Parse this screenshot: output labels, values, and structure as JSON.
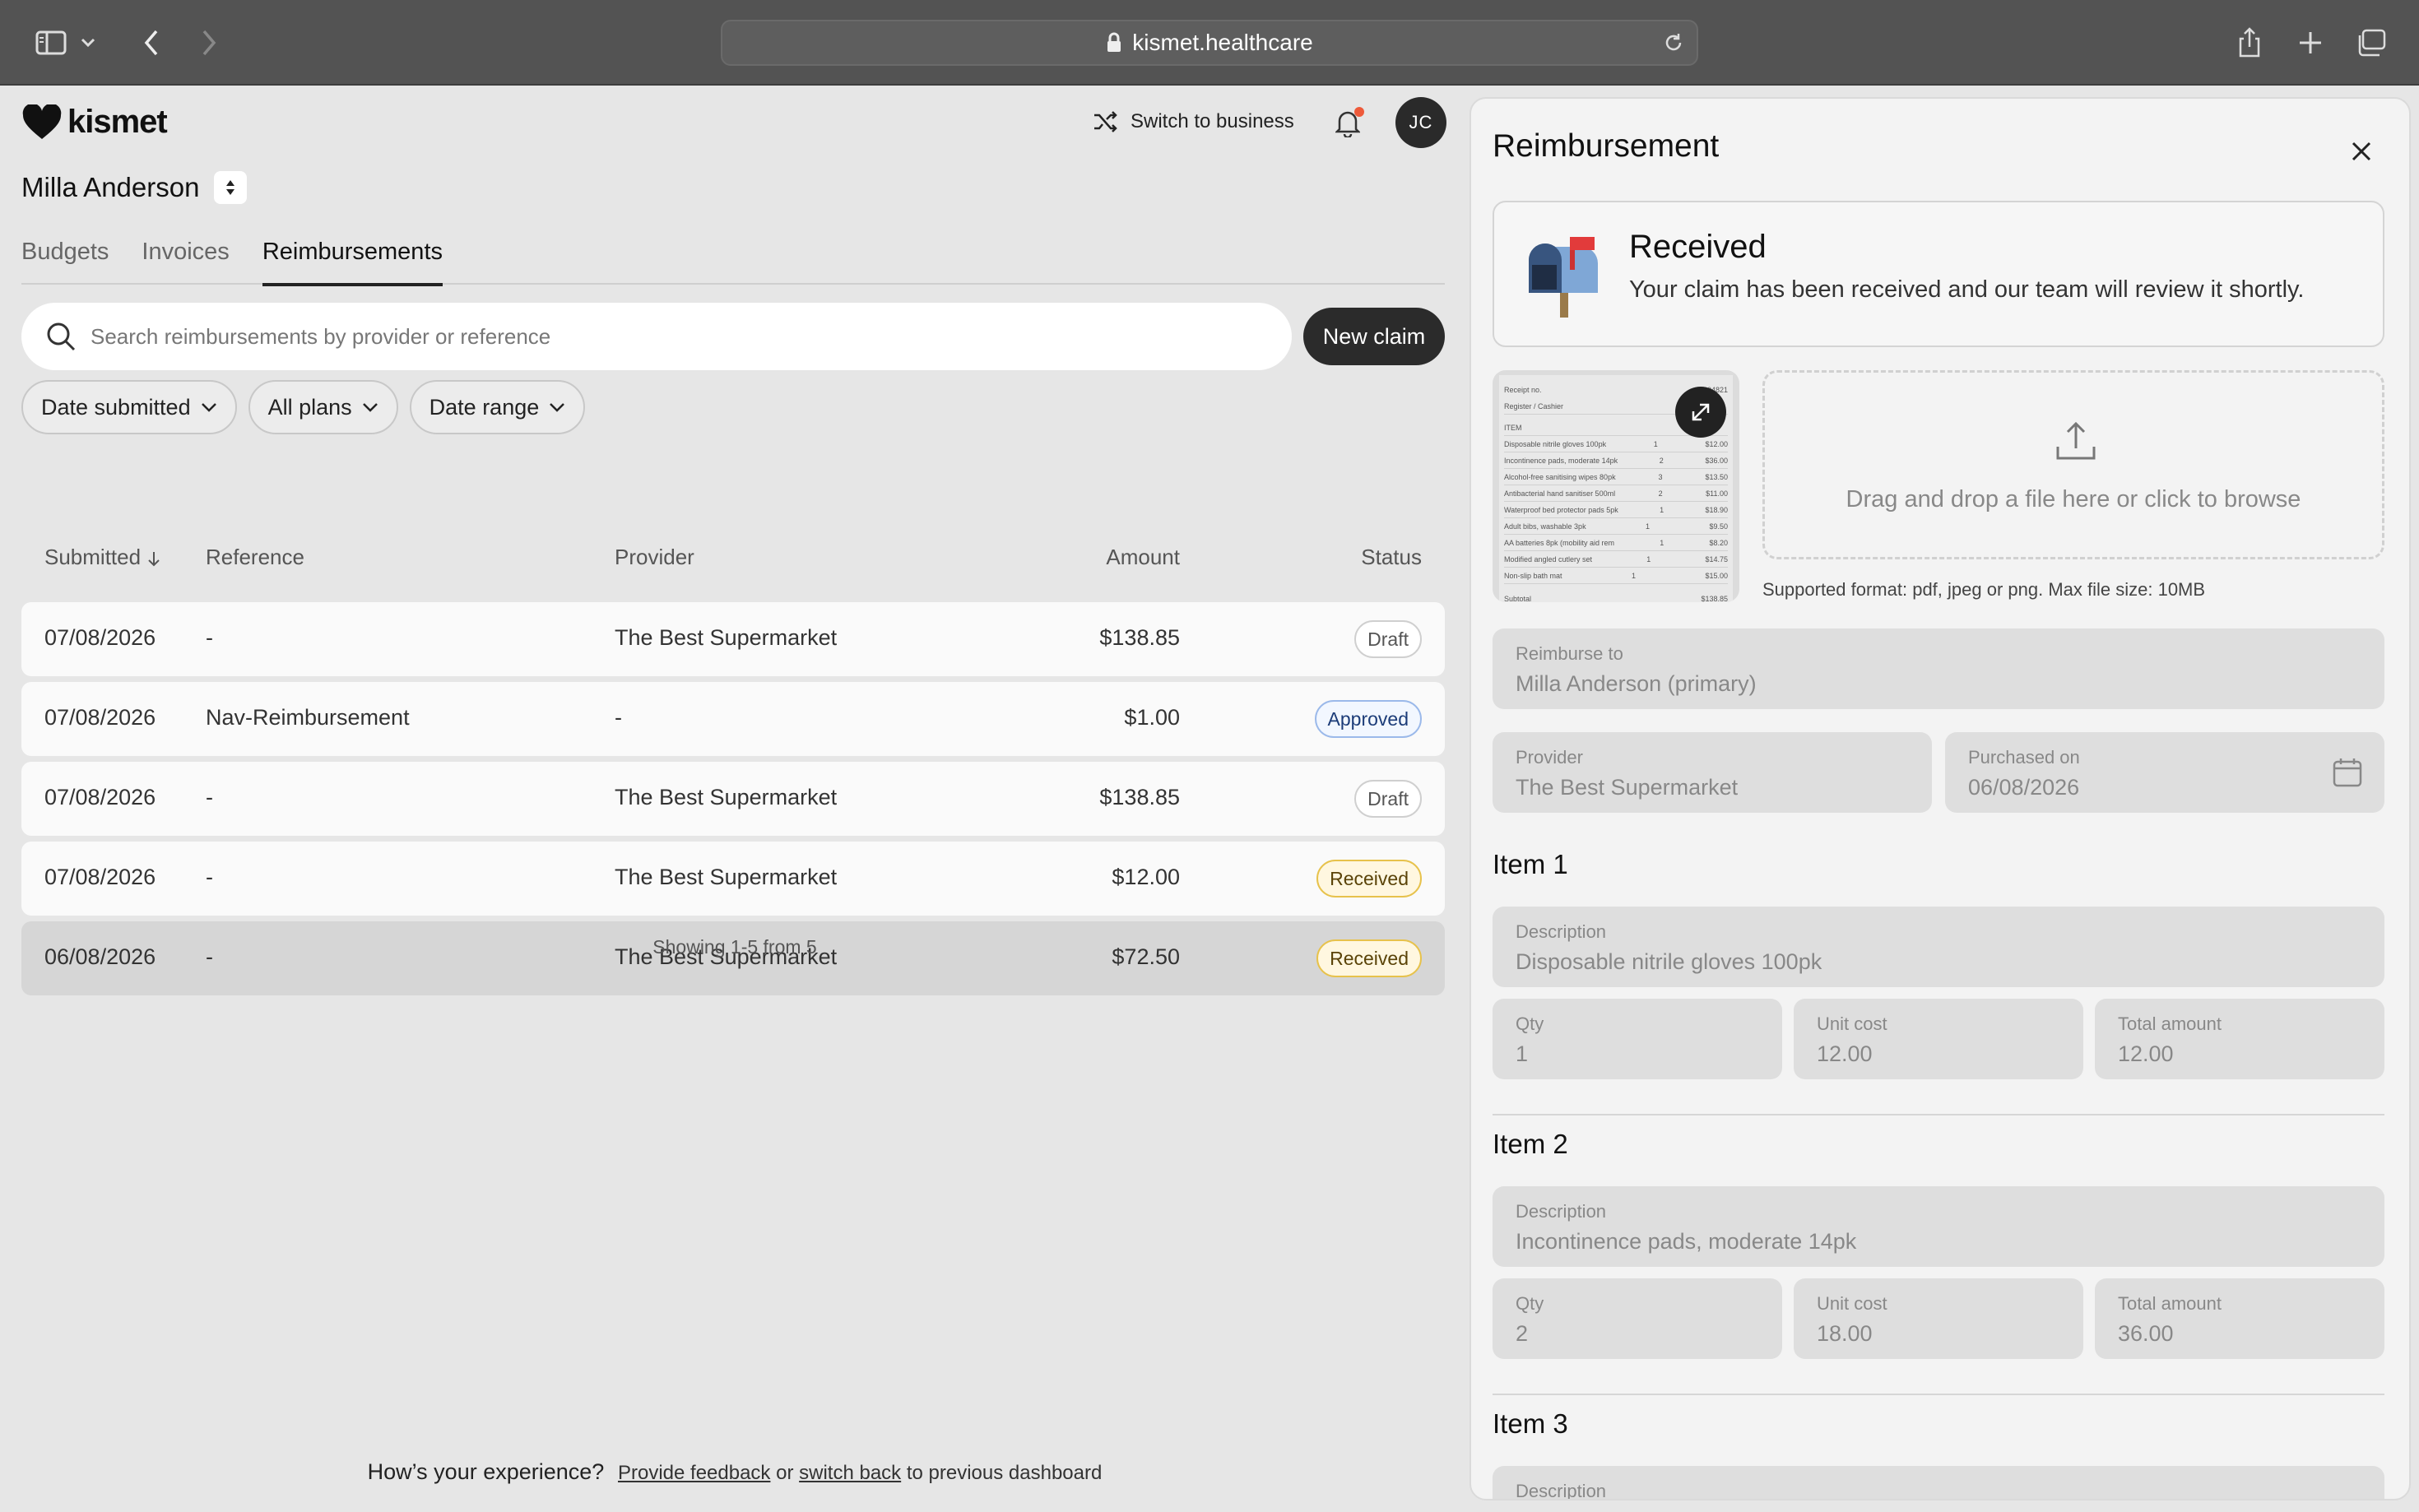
{
  "browser": {
    "url": "kismet.healthcare"
  },
  "header": {
    "logo": "kismet",
    "switch_label": "Switch to business",
    "avatar_initials": "JC"
  },
  "member": {
    "name": "Milla Anderson"
  },
  "tabs": [
    {
      "label": "Budgets"
    },
    {
      "label": "Invoices"
    },
    {
      "label": "Reimbursements"
    }
  ],
  "search": {
    "placeholder": "Search reimbursements by provider or reference",
    "new_claim": "New claim"
  },
  "filters": [
    {
      "label": "Date submitted"
    },
    {
      "label": "All plans"
    },
    {
      "label": "Date range"
    }
  ],
  "table": {
    "columns": [
      "Submitted",
      "Reference",
      "Provider",
      "Amount",
      "Status"
    ],
    "rows": [
      {
        "submitted": "07/08/2026",
        "reference": "-",
        "provider": "The Best Supermarket",
        "amount": "$138.85",
        "status": "Draft"
      },
      {
        "submitted": "07/08/2026",
        "reference": "Nav-Reimbursement",
        "provider": "-",
        "amount": "$1.00",
        "status": "Approved"
      },
      {
        "submitted": "07/08/2026",
        "reference": "-",
        "provider": "The Best Supermarket",
        "amount": "$138.85",
        "status": "Draft"
      },
      {
        "submitted": "07/08/2026",
        "reference": "-",
        "provider": "The Best Supermarket",
        "amount": "$12.00",
        "status": "Received"
      },
      {
        "submitted": "06/08/2026",
        "reference": "-",
        "provider": "The Best Supermarket",
        "amount": "$72.50",
        "status": "Received"
      }
    ],
    "showing": "Showing 1-5 from 5"
  },
  "feedback": {
    "question": "How’s your experience?",
    "link1": "Provide feedback",
    "or": "or",
    "link2": "switch back",
    "suffix": "to previous dashboard"
  },
  "panel": {
    "title": "Reimbursement",
    "status_title": "Received",
    "status_desc": "Your claim has been received and our team will review it shortly.",
    "receipt": {
      "header_left": "Receipt no.",
      "header_right": "0004821",
      "sub": "Register / Cashier",
      "col_item": "ITEM",
      "lines": [
        {
          "name": "Disposable nitrile gloves 100pk",
          "qty": "1",
          "price": "$12.00"
        },
        {
          "name": "Incontinence pads, moderate 14pk",
          "qty": "2",
          "price": "$36.00"
        },
        {
          "name": "Alcohol-free sanitising wipes 80pk",
          "qty": "3",
          "price": "$13.50"
        },
        {
          "name": "Antibacterial hand sanitiser 500ml",
          "qty": "2",
          "price": "$11.00"
        },
        {
          "name": "Waterproof bed protector pads 5pk",
          "qty": "1",
          "price": "$18.90"
        },
        {
          "name": "Adult bibs, washable 3pk",
          "qty": "1",
          "price": "$9.50"
        },
        {
          "name": "AA batteries 8pk (mobility aid rem",
          "qty": "1",
          "price": "$8.20"
        },
        {
          "name": "Modified angled cutlery set",
          "qty": "1",
          "price": "$14.75"
        },
        {
          "name": "Non-slip bath mat",
          "qty": "1",
          "price": "$15.00"
        }
      ],
      "subtotal_label": "Subtotal",
      "subtotal": "$138.85"
    },
    "upload_text": "Drag and drop a file here or click to browse",
    "support": "Supported format: pdf, jpeg or png. Max file size: 10MB",
    "reimburse_to": {
      "label": "Reimburse to",
      "value": "Milla Anderson (primary)"
    },
    "provider": {
      "label": "Provider",
      "value": "The Best Supermarket"
    },
    "purchased": {
      "label": "Purchased on",
      "value": "06/08/2026"
    },
    "items": [
      {
        "heading": "Item 1",
        "desc_label": "Description",
        "desc": "Disposable nitrile gloves 100pk",
        "qty_label": "Qty",
        "qty": "1",
        "unit_label": "Unit cost",
        "unit": "12.00",
        "total_label": "Total amount",
        "total": "12.00"
      },
      {
        "heading": "Item 2",
        "desc_label": "Description",
        "desc": "Incontinence pads, moderate 14pk",
        "qty_label": "Qty",
        "qty": "2",
        "unit_label": "Unit cost",
        "unit": "18.00",
        "total_label": "Total amount",
        "total": "36.00"
      },
      {
        "heading": "Item 3",
        "desc_label": "Description"
      }
    ]
  }
}
